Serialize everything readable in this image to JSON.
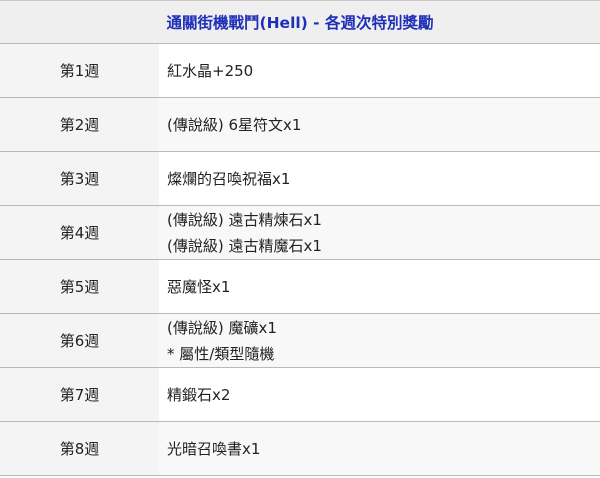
{
  "table": {
    "title": "通關街機戰鬥(Hell) - 各週次特別獎勵",
    "rows": [
      {
        "week": "第1週",
        "rewards": [
          "紅水晶+250"
        ]
      },
      {
        "week": "第2週",
        "rewards": [
          "(傳說級) 6星符文x1"
        ]
      },
      {
        "week": "第3週",
        "rewards": [
          "燦爛的召喚祝福x1"
        ]
      },
      {
        "week": "第4週",
        "rewards": [
          "(傳說級) 遠古精煉石x1",
          "(傳說級) 遠古精魔石x1"
        ]
      },
      {
        "week": "第5週",
        "rewards": [
          "惡魔怪x1"
        ]
      },
      {
        "week": "第6週",
        "rewards": [
          "(傳說級) 魔礦x1",
          "* 屬性/類型隨機"
        ]
      },
      {
        "week": "第7週",
        "rewards": [
          "精鍛石x2"
        ]
      },
      {
        "week": "第8週",
        "rewards": [
          "光暗召喚書x1"
        ]
      }
    ]
  }
}
